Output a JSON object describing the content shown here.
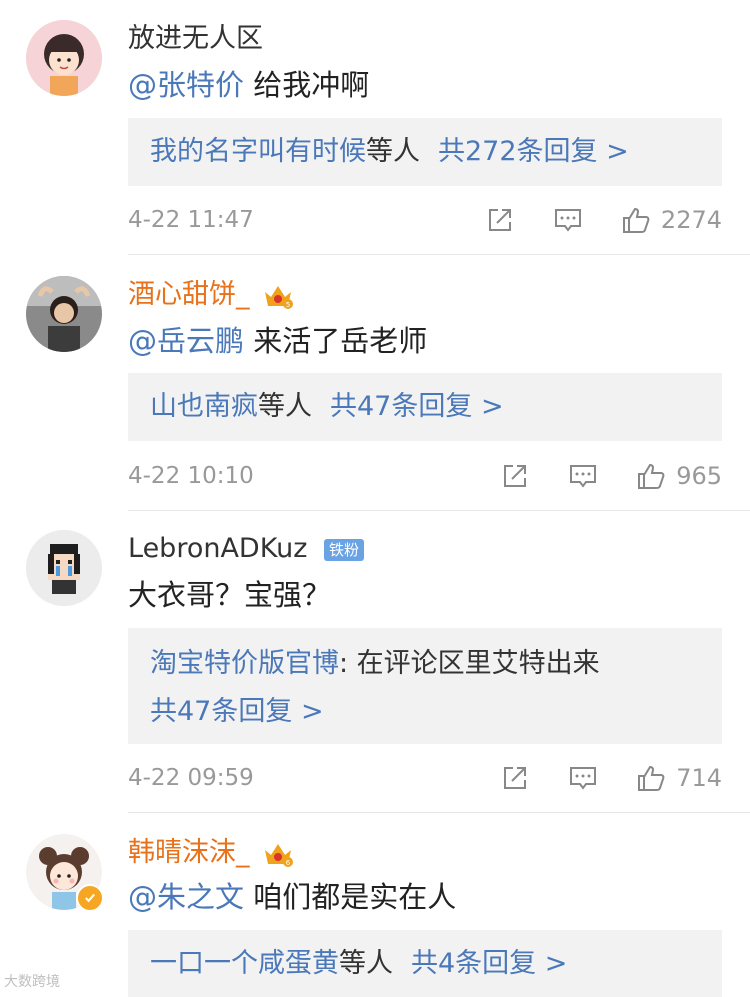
{
  "comments": [
    {
      "name": "放进无人区",
      "mention": "@张特价",
      "text": "给我冲啊",
      "reply_user": "我的名字叫有时候",
      "reply_suffix": "等人",
      "reply_count": "共272条回复 >",
      "time": "4-22 11:47",
      "likes": "2274"
    },
    {
      "name": "酒心甜饼_",
      "mention": "@岳云鹏",
      "text": "来活了岳老师",
      "reply_user": "山也南疯",
      "reply_suffix": "等人",
      "reply_count": "共47条回复 >",
      "time": "4-22 10:10",
      "likes": "965"
    },
    {
      "name": "LebronADKuz",
      "badge": "铁粉",
      "text": "大衣哥？宝强？",
      "reply_user": "淘宝特价版官博",
      "reply_text": ": 在评论区里艾特出来",
      "reply_count": "共47条回复 >",
      "time": "4-22 09:59",
      "likes": "714"
    },
    {
      "name": "韩晴沫沫_",
      "mention": "@朱之文",
      "text": "咱们都是实在人",
      "reply_user": "一口一个咸蛋黄",
      "reply_suffix": "等人",
      "reply_count": "共4条回复 >",
      "crown_level": "6"
    }
  ],
  "crown_level_2": "5",
  "watermark": "大数跨境",
  "colors": {
    "link": "#4b78b8",
    "vip_name": "#e8721b",
    "meta": "#999999",
    "reply_bg": "#f2f2f2"
  }
}
